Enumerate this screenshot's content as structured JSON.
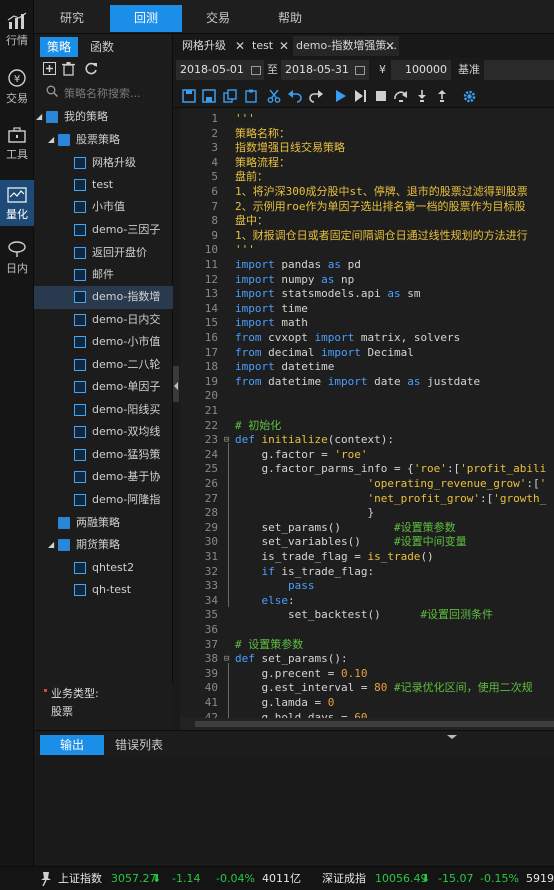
{
  "rail": [
    {
      "label": "行情",
      "icon": "market-chart-icon",
      "active": false
    },
    {
      "label": "交易",
      "icon": "trade-yen-icon",
      "active": false
    },
    {
      "label": "工具",
      "icon": "toolbox-icon",
      "active": false
    },
    {
      "label": "量化",
      "icon": "quant-wave-icon",
      "active": true
    },
    {
      "label": "日内",
      "icon": "intraday-icon",
      "active": false
    }
  ],
  "topnav": {
    "tabs": [
      {
        "label": "研究",
        "active": false
      },
      {
        "label": "回测",
        "active": true
      },
      {
        "label": "交易",
        "active": false
      },
      {
        "label": "帮助",
        "active": false
      }
    ]
  },
  "panel": {
    "tabs": [
      {
        "label": "策略",
        "active": true
      },
      {
        "label": "函数",
        "active": false
      }
    ],
    "search_placeholder": "策略名称搜索...",
    "tree": [
      {
        "label": "我的策略",
        "type": "folder",
        "level": 0,
        "expanded": true
      },
      {
        "label": "股票策略",
        "type": "folder",
        "level": 1,
        "expanded": true
      },
      {
        "label": "网格升级",
        "type": "file",
        "level": 2
      },
      {
        "label": "test",
        "type": "file",
        "level": 2
      },
      {
        "label": "小市值",
        "type": "file",
        "level": 2
      },
      {
        "label": "demo-三因子",
        "type": "file",
        "level": 2
      },
      {
        "label": "返回开盘价",
        "type": "file",
        "level": 2
      },
      {
        "label": "邮件",
        "type": "file",
        "level": 2
      },
      {
        "label": "demo-指数增",
        "type": "file",
        "level": 2,
        "selected": true
      },
      {
        "label": "demo-日内交",
        "type": "file",
        "level": 2
      },
      {
        "label": "demo-小市值",
        "type": "file",
        "level": 2
      },
      {
        "label": "demo-二八轮",
        "type": "file",
        "level": 2
      },
      {
        "label": "demo-单因子",
        "type": "file",
        "level": 2
      },
      {
        "label": "demo-阳线买",
        "type": "file",
        "level": 2
      },
      {
        "label": "demo-双均线",
        "type": "file",
        "level": 2
      },
      {
        "label": "demo-猛犸策",
        "type": "file",
        "level": 2
      },
      {
        "label": "demo-基于协",
        "type": "file",
        "level": 2
      },
      {
        "label": "demo-阿隆指",
        "type": "file",
        "level": 2
      },
      {
        "label": "两融策略",
        "type": "folder",
        "level": 1,
        "expanded": false
      },
      {
        "label": "期货策略",
        "type": "folder",
        "level": 1,
        "expanded": true
      },
      {
        "label": "qhtest2",
        "type": "file",
        "level": 2
      },
      {
        "label": "qh-test",
        "type": "file",
        "level": 2
      }
    ],
    "business_type_label": "业务类型:",
    "business_type_value": "股票"
  },
  "filetabs": [
    {
      "label": "网格升级",
      "active": false
    },
    {
      "label": "test",
      "active": false
    },
    {
      "label": "demo-指数增强策...",
      "active": true
    }
  ],
  "backtest": {
    "start_date": "2018-05-01",
    "to_label": "至",
    "end_date": "2018-05-31",
    "currency_symbol": "¥",
    "capital": "100000",
    "benchmark_label": "基准"
  },
  "toolbar_icons": [
    "save-icon",
    "save-as-icon",
    "copy-icon",
    "paste-icon",
    "cut-icon",
    "undo-icon",
    "redo-icon",
    "run-icon",
    "step-icon",
    "stop-icon",
    "step-over-icon",
    "step-into-icon",
    "step-out-icon",
    "settings-gear-icon"
  ],
  "code": {
    "start_line": 1,
    "lines": [
      [
        [
          "'''",
          "st"
        ]
      ],
      [
        [
          "策略名称：",
          "st"
        ]
      ],
      [
        [
          "指数增强日线交易策略",
          "st"
        ]
      ],
      [
        [
          "策略流程：",
          "st"
        ]
      ],
      [
        [
          "盘前：",
          "st"
        ]
      ],
      [
        [
          "1、将沪深300成分股中st、停牌、退市的股票过滤得到股票",
          "st"
        ]
      ],
      [
        [
          "2、示例用roe作为单因子选出排名第一档的股票作为目标股",
          "st"
        ]
      ],
      [
        [
          "盘中：",
          "st"
        ]
      ],
      [
        [
          "1、财报调仓日或者固定间隔调仓日通过线性规划的方法进行",
          "st"
        ]
      ],
      [
        [
          "'''",
          "st"
        ]
      ],
      [
        [
          "import",
          "kw"
        ],
        [
          " pandas ",
          ""
        ],
        [
          "as",
          "kw"
        ],
        [
          " pd",
          ""
        ]
      ],
      [
        [
          "import",
          "kw"
        ],
        [
          " numpy ",
          ""
        ],
        [
          "as",
          "kw"
        ],
        [
          " np",
          ""
        ]
      ],
      [
        [
          "import",
          "kw"
        ],
        [
          " statsmodels.api ",
          ""
        ],
        [
          "as",
          "kw"
        ],
        [
          " sm",
          ""
        ]
      ],
      [
        [
          "import",
          "kw"
        ],
        [
          " time",
          ""
        ]
      ],
      [
        [
          "import",
          "kw"
        ],
        [
          " math",
          ""
        ]
      ],
      [
        [
          "from",
          "kw"
        ],
        [
          " cvxopt ",
          ""
        ],
        [
          "import",
          "kw"
        ],
        [
          " matrix, solvers",
          ""
        ]
      ],
      [
        [
          "from",
          "kw"
        ],
        [
          " decimal ",
          ""
        ],
        [
          "import",
          "kw"
        ],
        [
          " Decimal",
          ""
        ]
      ],
      [
        [
          "import",
          "kw"
        ],
        [
          " datetime",
          ""
        ]
      ],
      [
        [
          "from",
          "kw"
        ],
        [
          " datetime ",
          ""
        ],
        [
          "import",
          "kw"
        ],
        [
          " date ",
          ""
        ],
        [
          "as",
          "kw"
        ],
        [
          " justdate",
          ""
        ]
      ],
      [],
      [],
      [
        [
          "# 初始化",
          "cm"
        ]
      ],
      [
        [
          "def",
          "df"
        ],
        [
          " ",
          ""
        ],
        [
          "initialize",
          "fn"
        ],
        [
          "(context):",
          ""
        ]
      ],
      [
        [
          "    g.factor = ",
          ""
        ],
        [
          "'roe'",
          "st"
        ]
      ],
      [
        [
          "    g.factor_parms_info = {",
          ""
        ],
        [
          "'roe'",
          "st"
        ],
        [
          ":[",
          ""
        ],
        [
          "'profit_abili",
          "st"
        ]
      ],
      [
        [
          "                    ",
          ""
        ],
        [
          "'operating_revenue_grow'",
          "st"
        ],
        [
          ":[",
          ""
        ],
        [
          "'",
          "st"
        ]
      ],
      [
        [
          "                    ",
          ""
        ],
        [
          "'net_profit_grow'",
          "st"
        ],
        [
          ":[",
          ""
        ],
        [
          "'growth_",
          "st"
        ]
      ],
      [
        [
          "                    }",
          ""
        ]
      ],
      [
        [
          "    set_params()        ",
          ""
        ],
        [
          "#设置策参数",
          "cm"
        ]
      ],
      [
        [
          "    set_variables()     ",
          ""
        ],
        [
          "#设置中间变量",
          "cm"
        ]
      ],
      [
        [
          "    is_trade_flag = ",
          ""
        ],
        [
          "is_trade",
          "fn"
        ],
        [
          "()",
          ""
        ]
      ],
      [
        [
          "    ",
          ""
        ],
        [
          "if",
          "kw"
        ],
        [
          " is_trade_flag:",
          ""
        ]
      ],
      [
        [
          "        ",
          ""
        ],
        [
          "pass",
          "kw"
        ]
      ],
      [
        [
          "    ",
          ""
        ],
        [
          "else",
          "kw"
        ],
        [
          ":",
          ""
        ]
      ],
      [
        [
          "        set_backtest()      ",
          ""
        ],
        [
          "#设置回测条件",
          "cm"
        ]
      ],
      [],
      [
        [
          "# 设置策参数",
          "cm"
        ]
      ],
      [
        [
          "def",
          "df"
        ],
        [
          " set_params():",
          ""
        ]
      ],
      [
        [
          "    g.precent = ",
          ""
        ],
        [
          "0.10",
          "nm"
        ]
      ],
      [
        [
          "    g.est_interval = ",
          ""
        ],
        [
          "80",
          "nm"
        ],
        [
          " ",
          ""
        ],
        [
          "#记录优化区间，使用二次规",
          "cm"
        ]
      ],
      [
        [
          "    g.lamda = ",
          ""
        ],
        [
          "0",
          "nm"
        ]
      ],
      [
        [
          "    g.hold_days = ",
          ""
        ],
        [
          "60",
          "nm"
        ]
      ]
    ]
  },
  "output_tabs": [
    {
      "label": "输出",
      "active": true
    },
    {
      "label": "错误列表",
      "active": false
    }
  ],
  "status": {
    "sh_name": "上证指数",
    "sh_value": "3057.27",
    "sh_change": "-1.14",
    "sh_pct": "-0.04%",
    "sh_volume": "4011亿",
    "sz_name": "深证成指",
    "sz_value": "10056.49",
    "sz_change": "-15.07",
    "sz_pct": "-0.15%",
    "sz_volume": "5919亿"
  },
  "colors": {
    "accent": "#1b8ee8",
    "down": "#28c840"
  }
}
